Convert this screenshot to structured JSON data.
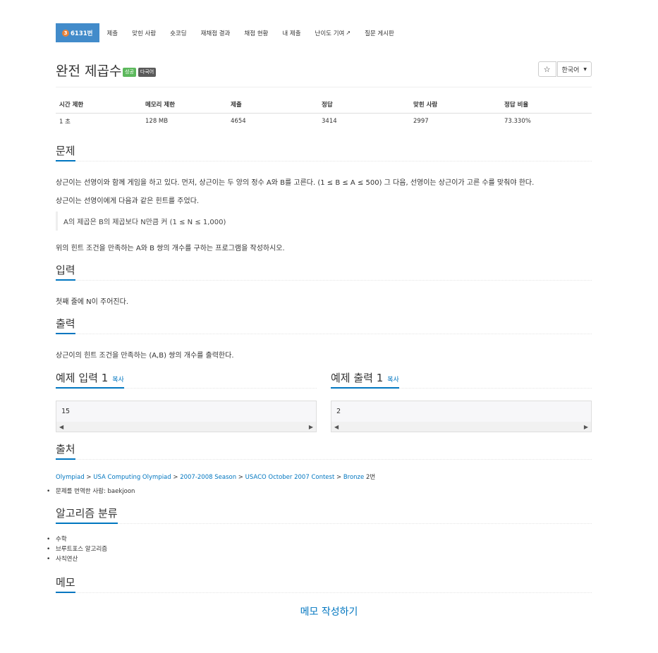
{
  "nav": {
    "problem_tier": "3",
    "problem_number": "6131번",
    "items": [
      "제출",
      "맞힌 사람",
      "숏코딩",
      "재채점 결과",
      "채점 현황",
      "내 제출",
      "난이도 기여",
      "질문 게시판"
    ]
  },
  "problem": {
    "title": "완전 제곱수",
    "badges": [
      "성공",
      "다국어"
    ],
    "language": "한국어"
  },
  "info": {
    "headers": [
      "시간 제한",
      "메모리 제한",
      "제출",
      "정답",
      "맞힌 사람",
      "정답 비율"
    ],
    "values": [
      "1 초",
      "128 MB",
      "4654",
      "3414",
      "2997",
      "73.330%"
    ]
  },
  "sections": {
    "problem": "문제",
    "input": "입력",
    "output": "출력",
    "sample_input": "예제 입력 1",
    "sample_output": "예제 출력 1",
    "copy": "복사",
    "source": "출처",
    "algorithm": "알고리즘 분류",
    "memo": "메모"
  },
  "description": {
    "line1": "상근이는 선영이와 함께 게임을 하고 있다. 먼저, 상근이는 두 양의 정수 A와 B를 고른다. (1 ≤ B ≤ A ≤ 500) 그 다음, 선영이는 상근이가 고른 수를 맞춰야 한다.",
    "line2": "상근이는 선영이에게 다음과 같은 힌트를 주었다.",
    "hint": "A의 제곱은 B의 제곱보다 N만큼 커 (1 ≤ N ≤ 1,000)",
    "line3": "위의 힌트 조건을 만족하는 A와 B 쌍의 개수를 구하는 프로그램을 작성하시오."
  },
  "input_text": "첫째 줄에 N이 주어진다.",
  "output_text": "상근이의 힌트 조건을 만족하는 (A,B) 쌍의 개수를 출력한다.",
  "samples": {
    "input": "15",
    "output": "2"
  },
  "source": {
    "links": [
      "Olympiad",
      "USA Computing Olympiad",
      "2007-2008 Season",
      "USACO October 2007 Contest",
      "Bronze"
    ],
    "separator": " > ",
    "suffix": "2번",
    "translator": "문제를 번역한 사람: baekjoon"
  },
  "algorithms": [
    "수학",
    "브루트포스 알고리즘",
    "사칙연산"
  ],
  "memo_write": "메모 작성하기",
  "colors": {
    "accent": "#0076c0",
    "nav_active": "#428bca",
    "success_badge": "#5cb85c",
    "multi_badge": "#5a5a5a",
    "tier_badge": "#e8823a"
  }
}
